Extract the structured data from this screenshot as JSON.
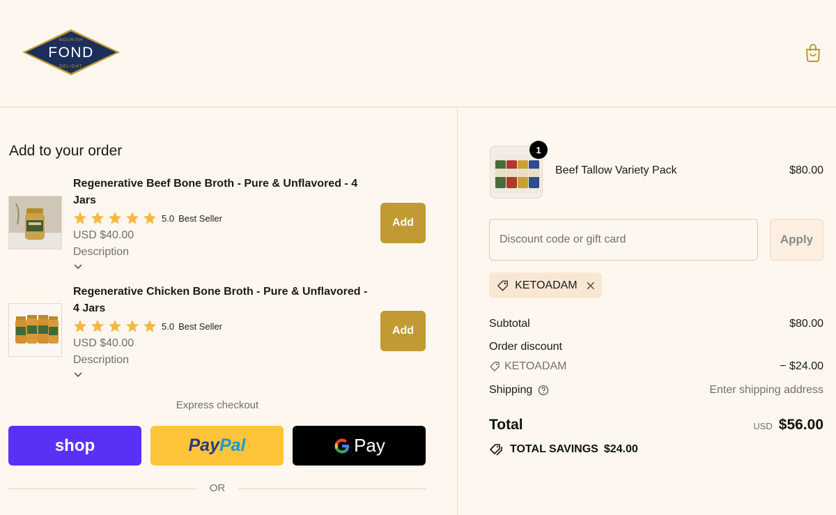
{
  "brand": {
    "logo_text": "FOND",
    "logo_top_text": "NOURISH",
    "logo_bottom_text": "DELIGHT",
    "navy": "#1c2f5b",
    "gold": "#c29a33"
  },
  "header": {
    "cart_icon": "shopping-bag-icon"
  },
  "upsell": {
    "title": "Add to your order",
    "products": [
      {
        "name": "Regenerative Beef Bone Broth - Pure & Unflavored - 4 Jars",
        "rating": "5.0",
        "stars": 5,
        "badge": "Best Seller",
        "price": "USD $40.00",
        "description_label": "Description",
        "add_label": "Add"
      },
      {
        "name": "Regenerative Chicken Bone Broth - Pure & Unflavored - 4 Jars",
        "rating": "5.0",
        "stars": 5,
        "badge": "Best Seller",
        "price": "USD $40.00",
        "description_label": "Description",
        "add_label": "Add"
      }
    ]
  },
  "express": {
    "label": "Express checkout",
    "shop_label": "shop",
    "paypal_label_1": "Pay",
    "paypal_label_2": "Pal",
    "gpay_label": "Pay",
    "or_label": "OR"
  },
  "summary": {
    "line_item": {
      "name": "Beef Tallow Variety Pack",
      "price": "$80.00",
      "quantity": "1"
    },
    "discount_placeholder": "Discount code or gift card",
    "apply_label": "Apply",
    "applied_code": "KETOADAM",
    "subtotal_label": "Subtotal",
    "subtotal_value": "$80.00",
    "order_discount_label": "Order discount",
    "discount_code_label": "KETOADAM",
    "discount_value": "− $24.00",
    "shipping_label": "Shipping",
    "shipping_value": "Enter shipping address",
    "total_label": "Total",
    "total_currency": "USD",
    "total_value": "$56.00",
    "savings_label": "TOTAL SAVINGS",
    "savings_value": "$24.00"
  }
}
